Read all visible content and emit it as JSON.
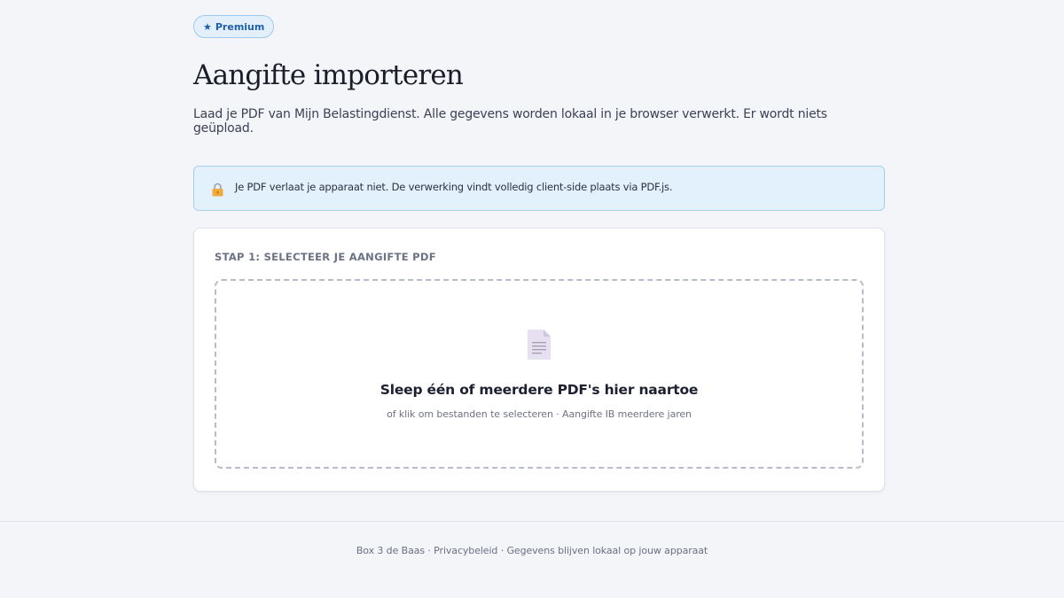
{
  "badge": {
    "icon": "star-icon",
    "label": "Premium"
  },
  "page": {
    "title": "Aangifte importeren",
    "subtitle": "Laad je PDF van Mijn Belastingdienst. Alle gegevens worden lokaal in je browser verwerkt. Er wordt niets geüpload."
  },
  "notice": {
    "icon": "lock-icon",
    "text": "Je PDF verlaat je apparaat niet. De verwerking vindt volledig client-side plaats via PDF.js."
  },
  "upload": {
    "step_label": "STAP 1: SELECTEER JE AANGIFTE PDF",
    "icon": "file-icon",
    "drop_title": "Sleep één of meerdere PDF's hier naartoe",
    "drop_hint": "of klik om bestanden te selecteren · Aangifte IB meerdere jaren"
  },
  "footer": {
    "text": "Box 3 de Baas · Privacybeleid · Gegevens blijven lokaal op jouw apparaat"
  },
  "colors": {
    "background": "#f4f5f9",
    "badge_bg": "#e3f0fc",
    "badge_text": "#1f5fa8",
    "notice_bg": "#e3f1fc",
    "notice_border": "#a7d0ef",
    "dropzone_border": "#b7bccb"
  }
}
